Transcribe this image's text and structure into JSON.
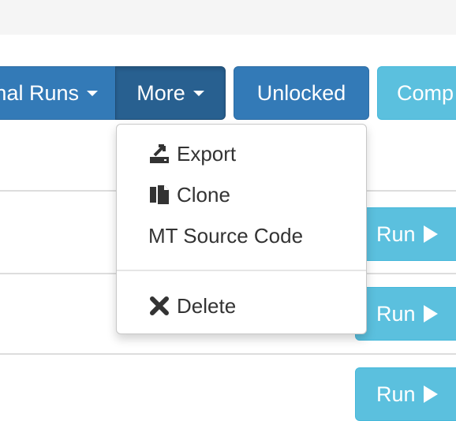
{
  "toolbar": {
    "internal_runs_label": "nal Runs",
    "more_label": "More",
    "unlocked_label": "Unlocked",
    "comp_label": "Comp"
  },
  "rows": [
    {
      "run_label": "Run"
    },
    {
      "run_label": "Run"
    },
    {
      "run_label": "Run"
    }
  ],
  "more_menu": {
    "items": [
      {
        "label": "Export",
        "icon": "export-icon"
      },
      {
        "label": "Clone",
        "icon": "clone-icon"
      },
      {
        "label": "MT Source Code",
        "icon": ""
      },
      {
        "label": "Delete",
        "icon": "delete-icon"
      }
    ]
  },
  "colors": {
    "primary": "#337ab7",
    "primary_active": "#286090",
    "info": "#5bc0de",
    "topbar": "#f5f5f5"
  }
}
